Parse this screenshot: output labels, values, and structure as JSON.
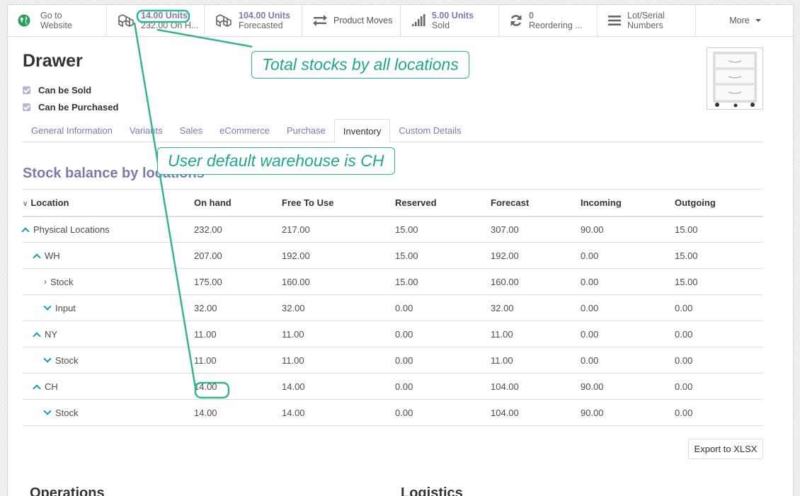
{
  "smart_buttons": {
    "website": {
      "line1": "Go to",
      "line2": "Website"
    },
    "on_hand": {
      "value": "14.00 Units",
      "label": "232.00 On H..."
    },
    "forecasted": {
      "value": "104.00 Units",
      "label": "Forecasted"
    },
    "product_moves": {
      "label": "Product Moves"
    },
    "sold": {
      "value": "5.00 Units",
      "label": "Sold"
    },
    "reordering": {
      "value": "0",
      "label": "Reordering ..."
    },
    "lots": {
      "line1": "Lot/Serial",
      "line2": "Numbers"
    },
    "more": {
      "label": "More"
    }
  },
  "product": {
    "name": "Drawer",
    "can_be_sold": "Can be Sold",
    "can_be_purchased": "Can be Purchased"
  },
  "tabs": [
    "General Information",
    "Variants",
    "Sales",
    "eCommerce",
    "Purchase",
    "Inventory",
    "Custom Details"
  ],
  "section_title": "Stock balance by locations",
  "table": {
    "headers": [
      "Location",
      "On hand",
      "Free To Use",
      "Reserved",
      "Forecast",
      "Incoming",
      "Outgoing"
    ],
    "rows": [
      {
        "location": "Physical Locations",
        "values": [
          "232.00",
          "217.00",
          "15.00",
          "307.00",
          "90.00",
          "15.00"
        ]
      },
      {
        "location": "WH",
        "values": [
          "207.00",
          "192.00",
          "15.00",
          "192.00",
          "0.00",
          "15.00"
        ]
      },
      {
        "location": "Stock",
        "values": [
          "175.00",
          "160.00",
          "15.00",
          "160.00",
          "0.00",
          "15.00"
        ]
      },
      {
        "location": "Input",
        "values": [
          "32.00",
          "32.00",
          "0.00",
          "32.00",
          "0.00",
          "0.00"
        ]
      },
      {
        "location": "NY",
        "values": [
          "11.00",
          "11.00",
          "0.00",
          "11.00",
          "0.00",
          "0.00"
        ]
      },
      {
        "location": "Stock",
        "values": [
          "11.00",
          "11.00",
          "0.00",
          "11.00",
          "0.00",
          "0.00"
        ]
      },
      {
        "location": "CH",
        "values": [
          "14.00",
          "14.00",
          "0.00",
          "104.00",
          "90.00",
          "0.00"
        ]
      },
      {
        "location": "Stock",
        "values": [
          "14.00",
          "14.00",
          "0.00",
          "104.00",
          "90.00",
          "0.00"
        ]
      }
    ]
  },
  "export_label": "Export to XLSX",
  "bottom_left": "Operations",
  "bottom_right": "Logistics",
  "annotations": {
    "total_stocks": "Total stocks by all locations",
    "default_warehouse": "User default warehouse is CH"
  },
  "colors": {
    "accent": "#7c7bad",
    "teal": "#0aa3a3",
    "annotation": "#2fb690"
  }
}
